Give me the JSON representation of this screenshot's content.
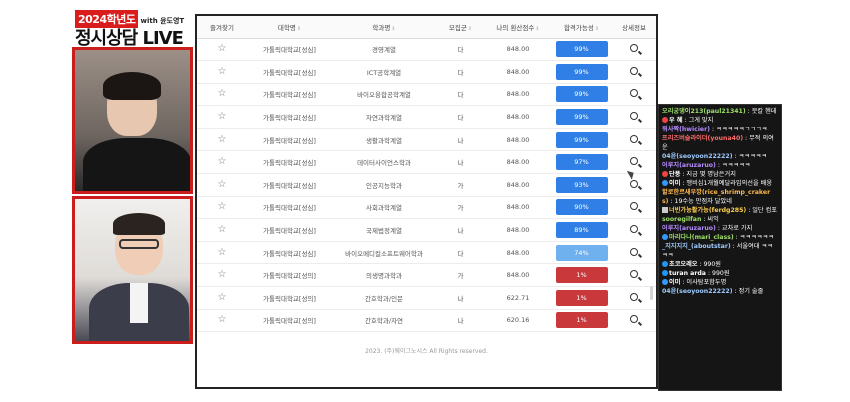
{
  "stream": {
    "year_tag": "2024학년도",
    "with_tag": "with 윤도영T",
    "title": "정시상담 LIVE"
  },
  "table": {
    "headers": [
      "즐겨찾기",
      "대학명",
      "학과명",
      "모집군",
      "나의 환산점수",
      "합격가능성",
      "상세정보"
    ],
    "sort_glyph": "⇕",
    "rows": [
      {
        "univ": "가톨릭대학교[성심]",
        "dept": "경영계열",
        "group": "다",
        "score": "848.00",
        "prob": "99%"
      },
      {
        "univ": "가톨릭대학교[성심]",
        "dept": "ICT공학계열",
        "group": "다",
        "score": "848.00",
        "prob": "99%"
      },
      {
        "univ": "가톨릭대학교[성심]",
        "dept": "바이오융합공학계열",
        "group": "다",
        "score": "848.00",
        "prob": "99%"
      },
      {
        "univ": "가톨릭대학교[성심]",
        "dept": "자연과학계열",
        "group": "다",
        "score": "848.00",
        "prob": "99%"
      },
      {
        "univ": "가톨릭대학교[성심]",
        "dept": "생활과학계열",
        "group": "나",
        "score": "848.00",
        "prob": "99%"
      },
      {
        "univ": "가톨릭대학교[성심]",
        "dept": "데이터사이언스학과",
        "group": "나",
        "score": "848.00",
        "prob": "97%"
      },
      {
        "univ": "가톨릭대학교[성심]",
        "dept": "인공지능학과",
        "group": "가",
        "score": "848.00",
        "prob": "93%"
      },
      {
        "univ": "가톨릭대학교[성심]",
        "dept": "사회과학계열",
        "group": "가",
        "score": "848.00",
        "prob": "90%"
      },
      {
        "univ": "가톨릭대학교[성심]",
        "dept": "국제법정계열",
        "group": "나",
        "score": "848.00",
        "prob": "89%"
      },
      {
        "univ": "가톨릭대학교[성심]",
        "dept": "바이오메디컬소프트웨어학과",
        "group": "다",
        "score": "848.00",
        "prob": "74%"
      },
      {
        "univ": "가톨릭대학교[성의]",
        "dept": "의생명과학과",
        "group": "가",
        "score": "848.00",
        "prob": "1%"
      },
      {
        "univ": "가톨릭대학교[성의]",
        "dept": "간호학과/인문",
        "group": "나",
        "score": "622.71",
        "prob": "1%"
      },
      {
        "univ": "가톨릭대학교[성의]",
        "dept": "간호학과/자연",
        "group": "나",
        "score": "620.16",
        "prob": "1%"
      }
    ],
    "footer": "2023. (주)웨이그노시스 All Rights reserved."
  },
  "colors": {
    "prob_high": "#2f7fe6",
    "prob_mid": "#6fb0ee",
    "prob_low": "#c9383b"
  },
  "chat": {
    "messages": [
      {
        "name": "오리궁댕이213(paul21341)",
        "text": ": 뭇칼 헨데",
        "color": "#9ee06a",
        "icon": ""
      },
      {
        "name": "우 혜",
        "text": ": 그게 맞지",
        "color": "#ffffff",
        "icon": "red"
      },
      {
        "name": "워사짝(hwicier)",
        "text": ": ㅋㅋㅋㅋㅋㄱㄱㄱㅋ",
        "color": "#b48cff",
        "icon": ""
      },
      {
        "name": "프리즈버슬라이더(youna40)",
        "text": ": 무적 의여운",
        "color": "#ff6b6b",
        "icon": ""
      },
      {
        "name": "04윤(seoyoon22222)",
        "text": ": ㅋㅋㅋㅋㅋ",
        "color": "#9ecbff",
        "icon": ""
      },
      {
        "name": "어루지(aruzaruo)",
        "text": ": ㅋㅋㅋㅋㅋ",
        "color": "#b48cff",
        "icon": ""
      },
      {
        "name": "단풍",
        "text": ": 지금 몇 명남은거지",
        "color": "#ffffff",
        "icon": "red"
      },
      {
        "name": "이미",
        "text": ": 맹비심1개월예달라임의선을 배웅",
        "color": "#ffffff",
        "icon": "blue"
      },
      {
        "name": "할로한르새우깡(rice_shrimp_craker s)",
        "text": ": 19수능 만점자 달았네",
        "color": "#ffb84d",
        "icon": ""
      },
      {
        "name": "너빈가능활가능(ferdg285)",
        "text": ": 일단 컴포",
        "color": "#ffd04d",
        "icon": "sq"
      },
      {
        "name": "sooregilfan",
        "text": ": 씨익",
        "color": "#9ee06a",
        "icon": ""
      },
      {
        "name": "어루지(aruzaruo)",
        "text": ": 교차로 가지",
        "color": "#b48cff",
        "icon": ""
      },
      {
        "name": "마리다나(mari_class)",
        "text": ": ㅋㅋㅋㅋㅋㅋ",
        "color": "#9ee06a",
        "icon": "blue"
      },
      {
        "name": "_지지지지_(aboutstar)",
        "text": ": 서울여대 ㅋㅋㅋㅋ",
        "color": "#9ecbff",
        "icon": ""
      },
      {
        "name": "초코오레오",
        "text": ": 990원",
        "color": "#ffffff",
        "icon": "money"
      },
      {
        "name": "turan arda",
        "text": ": 990원",
        "color": "#ffffff",
        "icon": "money"
      },
      {
        "name": "이미",
        "text": ": 이사탐포함두명",
        "color": "#ffffff",
        "icon": "blue"
      },
      {
        "name": "04윤(seoyoon22222)",
        "text": ": 정기 술줄",
        "color": "#9ecbff",
        "icon": ""
      }
    ]
  }
}
